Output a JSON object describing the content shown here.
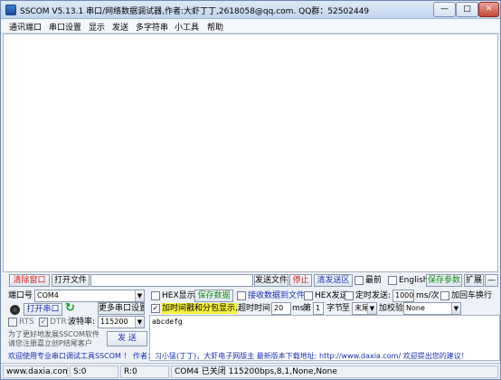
{
  "window": {
    "title": "SSCOM V5.13.1 串口/网络数据调试器,作者:大虾丁丁,2618058@qq.com. QQ群：52502449",
    "min_label": "—",
    "max_label": "□",
    "close_label": "✕"
  },
  "menu": [
    "通讯端口",
    "串口设置",
    "显示",
    "发送",
    "多字符串",
    "小工具",
    "帮助"
  ],
  "toolbar": {
    "clear_window": "清除窗口",
    "open_file": "打开文件",
    "file_path": "",
    "send_file": "发送文件",
    "stop": "停止",
    "clear_send": "清发送区",
    "latest_label": "最前",
    "english_label": "English",
    "save_params": "保存参数",
    "expand": "扩展",
    "collapse": "—"
  },
  "port": {
    "port_label": "端口号",
    "port_value": "COM4",
    "more_settings": "更多串口设置",
    "open_port": "打开串口",
    "rts_label": "RTS",
    "dtr_label": "DTR",
    "baud_label": "波特率:",
    "baud_value": "115200",
    "tip_line1": "为了更好地发展SSCOM软件",
    "tip_line2": "请您注册嘉立创P结尾客户",
    "send_button": "发 送"
  },
  "options": {
    "hex_display": "HEX显示",
    "save_data": "保存数据",
    "recv_to_file": "接收数据到文件",
    "hex_send": "HEX发送",
    "timed_send": "定时发送:",
    "interval_value": "1000",
    "interval_unit": "ms/次",
    "add_crlf": "加回车换行",
    "timestamp_split": "加时间戳和分包显示,",
    "timeout_label": "超时时间:",
    "timeout_value": "20",
    "timeout_unit": "ms",
    "byte_prefix": "第",
    "byte_value": "1",
    "byte_label": "字节",
    "to_label": "至",
    "end_value": "末尾",
    "checksum_label": "加校验",
    "checksum_value": "None"
  },
  "send_text": "abcdefg",
  "promo": {
    "text": "欢迎使用专业串口调试工具SSCOM ！  作者：习小猛(丁丁)，大虾电子网版主  最新版本下载地址: http://www.daxia.com/  欢迎提出您的建议！"
  },
  "status": {
    "site": "www.daxia.com",
    "s_count": "S:0",
    "r_count": "R:0",
    "port_status": "COM4 已关闭  115200bps,8,1,None,None"
  },
  "colors": {
    "red": "#d11a1a",
    "green": "#0c8a16",
    "blue": "#1a2fb8",
    "highlight": "#f7f13a"
  }
}
